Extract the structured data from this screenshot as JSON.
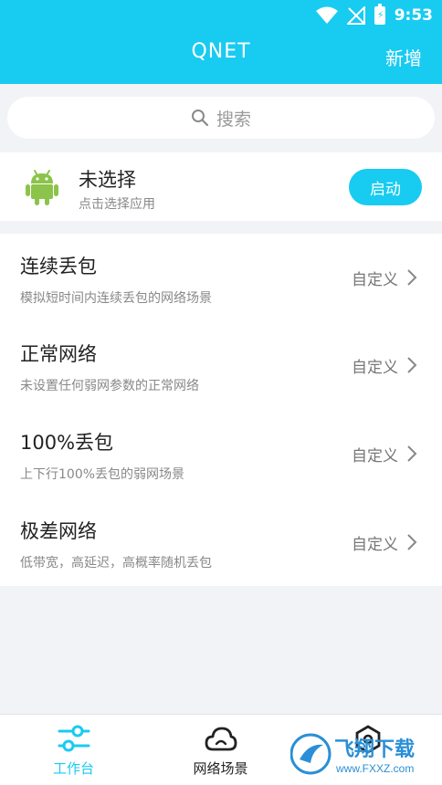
{
  "status": {
    "time": "9:53"
  },
  "header": {
    "title": "QNET",
    "add_label": "新增"
  },
  "search": {
    "placeholder": "搜索"
  },
  "app_selector": {
    "name": "未选择",
    "hint": "点击选择应用",
    "start_label": "启动"
  },
  "scenes": [
    {
      "title": "连续丢包",
      "desc": "模拟短时间内连续丢包的网络场景",
      "action": "自定义"
    },
    {
      "title": "正常网络",
      "desc": "未设置任何弱网参数的正常网络",
      "action": "自定义"
    },
    {
      "title": "100%丢包",
      "desc": "上下行100%丢包的弱网场景",
      "action": "自定义"
    },
    {
      "title": "极差网络",
      "desc": "低带宽，高延迟，高概率随机丢包",
      "action": "自定义"
    }
  ],
  "tabs": [
    {
      "label": "工作台",
      "icon": "sliders-icon",
      "active": true
    },
    {
      "label": "网络场景",
      "icon": "cloud-icon",
      "active": false
    },
    {
      "label": "",
      "icon": "settings-icon",
      "active": false
    }
  ],
  "watermark": {
    "text": "飞翔下载",
    "url": "www.FXXZ.com"
  },
  "colors": {
    "accent": "#18cbf1",
    "android": "#8cc34a",
    "text_primary": "#222222",
    "text_secondary": "#888888"
  }
}
